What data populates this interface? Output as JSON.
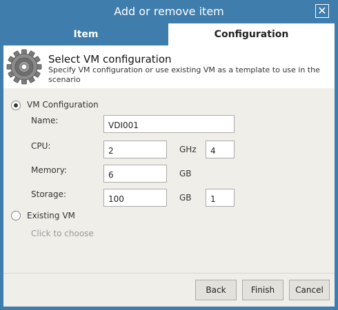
{
  "window": {
    "title": "Add or remove item",
    "close_symbol": "✕"
  },
  "tabs": [
    {
      "label": "Item",
      "active": false
    },
    {
      "label": "Configuration",
      "active": true
    }
  ],
  "header": {
    "icon": "gear-icon",
    "title": "Select VM configuration",
    "description": "Specify VM configuration or use existing VM as a template to use in the scenario"
  },
  "options": {
    "vm_config": {
      "label": "VM Configuration",
      "selected": true
    },
    "existing_vm": {
      "label": "Existing VM",
      "selected": false,
      "hint": "Click to choose"
    }
  },
  "fields": {
    "name": {
      "label": "Name:",
      "value": "VDI001"
    },
    "cpu": {
      "label": "CPU:",
      "value": "2",
      "unit": "GHz",
      "extra": "4"
    },
    "memory": {
      "label": "Memory:",
      "value": "6",
      "unit": "GB"
    },
    "storage": {
      "label": "Storage:",
      "value": "100",
      "unit": "GB",
      "extra": "1"
    }
  },
  "buttons": {
    "back": "Back",
    "finish": "Finish",
    "cancel": "Cancel"
  },
  "colors": {
    "accent": "#3e7dac",
    "panel": "#f0eee8"
  }
}
